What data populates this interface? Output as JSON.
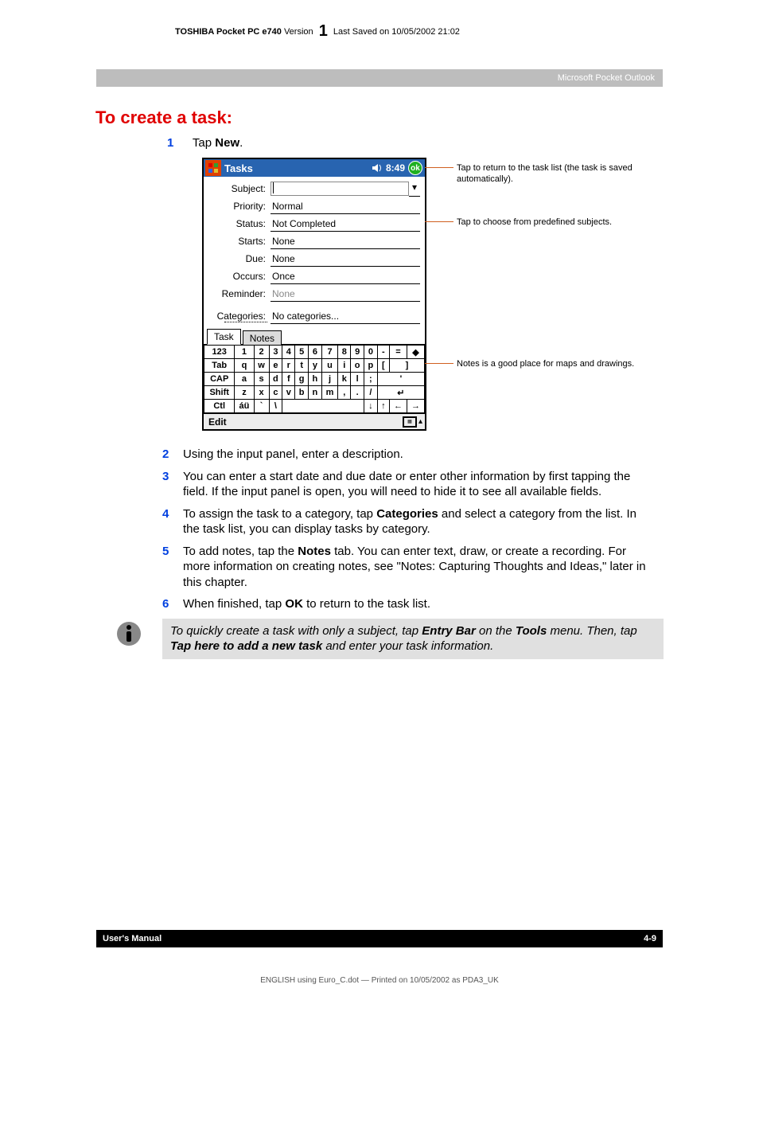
{
  "header": {
    "left_bold": "TOSHIBA Pocket PC e740",
    "version_word": "Version",
    "version_num": "1",
    "right": "Last Saved on 10/05/2002 21:02"
  },
  "section_bar": "Microsoft Pocket Outlook",
  "heading": "To create a task:",
  "step1_num": "1",
  "step1_text_pre": "Tap ",
  "step1_text_bold": "New",
  "step1_text_post": ".",
  "screenshot": {
    "title": "Tasks",
    "time": "8:49",
    "ok": "ok",
    "rows": {
      "subject_lbl": "Subject:",
      "priority_lbl": "Priority:",
      "priority_val": "Normal",
      "status_lbl": "Status:",
      "status_val": "Not Completed",
      "starts_lbl": "Starts:",
      "starts_val": "None",
      "due_lbl": "Due:",
      "due_val": "None",
      "occurs_lbl": "Occurs:",
      "occurs_val": "Once",
      "reminder_lbl": "Reminder:",
      "reminder_val": "None",
      "categories_lbl": "Categories:",
      "categories_val": "No categories..."
    },
    "tabs": {
      "task": "Task",
      "notes": "Notes"
    },
    "kb": {
      "r1": [
        "123",
        "1",
        "2",
        "3",
        "4",
        "5",
        "6",
        "7",
        "8",
        "9",
        "0",
        "-",
        "=",
        "◆"
      ],
      "r2": [
        "Tab",
        "q",
        "w",
        "e",
        "r",
        "t",
        "y",
        "u",
        "i",
        "o",
        "p",
        "[",
        "]"
      ],
      "r3": [
        "CAP",
        "a",
        "s",
        "d",
        "f",
        "g",
        "h",
        "j",
        "k",
        "l",
        ";",
        "'"
      ],
      "r4": [
        "Shift",
        "z",
        "x",
        "c",
        "v",
        "b",
        "n",
        "m",
        ",",
        ".",
        "/",
        "↵"
      ],
      "r5": [
        "Ctl",
        "áü",
        "`",
        "\\",
        "",
        "↓",
        "↑",
        "←",
        "→"
      ]
    },
    "edit": "Edit"
  },
  "callouts": {
    "c1": "Tap to return to the task list (the task is saved automatically).",
    "c2": "Tap to choose from predefined subjects.",
    "c3": "Notes is a good place for maps and drawings."
  },
  "steps": [
    {
      "num": "2",
      "text": "Using the input panel, enter a description."
    },
    {
      "num": "3",
      "text": "You can enter a start date and due date or enter other information by first tapping the field. If the input panel is open, you will need to hide it to see all available fields."
    },
    {
      "num": "4",
      "t1": "To assign the task to a category, tap ",
      "b1": "Categories",
      "t2": " and select a category from the list. In the task list, you can display tasks by category."
    },
    {
      "num": "5",
      "t1": "To add notes, tap the ",
      "b1": "Notes",
      "t2": " tab. You can enter text, draw, or create a recording. For more information on creating notes, see \"Notes: Capturing Thoughts and Ideas,\" later in this chapter."
    },
    {
      "num": "6",
      "t1": "When finished, tap ",
      "b1": "OK",
      "t2": " to return to the task list."
    }
  ],
  "tip": {
    "t1": "To quickly create a task with only a subject, tap ",
    "b1": "Entry Bar",
    "t2": " on the ",
    "b2": "Tools",
    "t3": " menu. Then, tap ",
    "b3": "Tap here to add a new task",
    "t4": " and enter your task information."
  },
  "footer": {
    "left": "User's Manual",
    "right": "4-9"
  },
  "print_line": "ENGLISH using  Euro_C.dot — Printed on 10/05/2002 as PDA3_UK"
}
